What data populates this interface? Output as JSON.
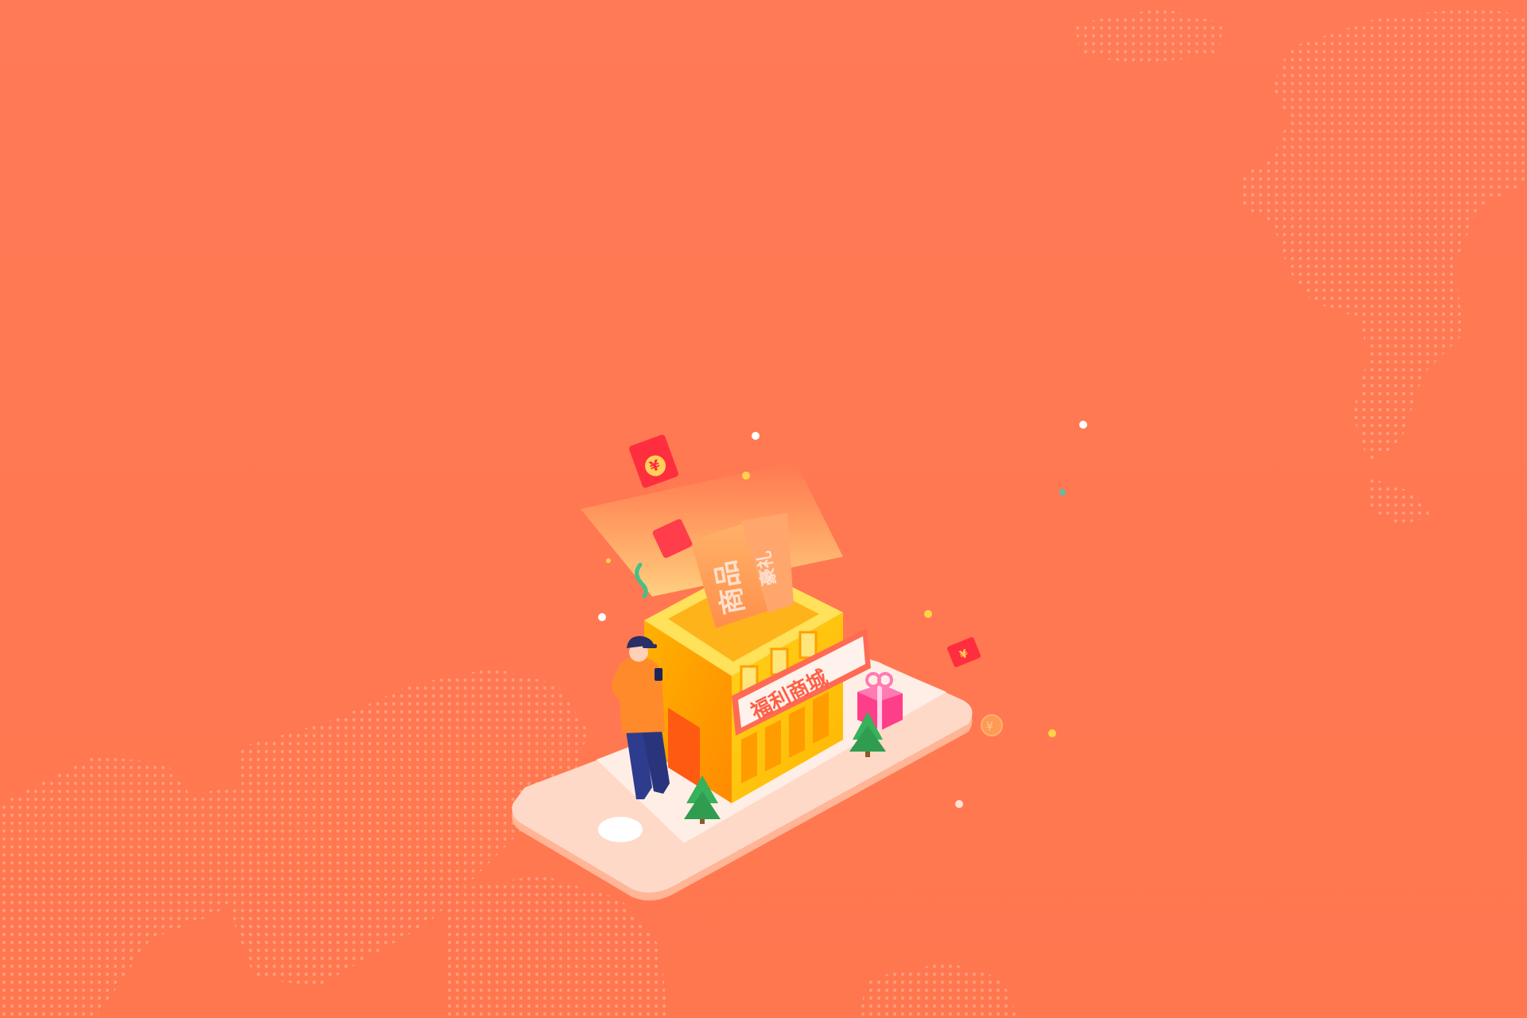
{
  "colors": {
    "background": "#ff7953",
    "map_dots": "#ff9a7a",
    "phone_body": "#ffd7c3",
    "phone_screen": "#ffe9de",
    "shop_primary": "#ffc20a",
    "shop_dark": "#ff9100",
    "banner": "#ff6a55",
    "person_shirt": "#ff8a2b",
    "person_pants": "#2f3e8e",
    "tree": "#37b15a",
    "gift": "#ff3e8a"
  },
  "illustration": {
    "signboard_text": "福利商城",
    "ticket_text_1": "商品",
    "ticket_text_2": "豪礼",
    "envelope_symbol": "¥",
    "coin_symbol": "¥"
  }
}
